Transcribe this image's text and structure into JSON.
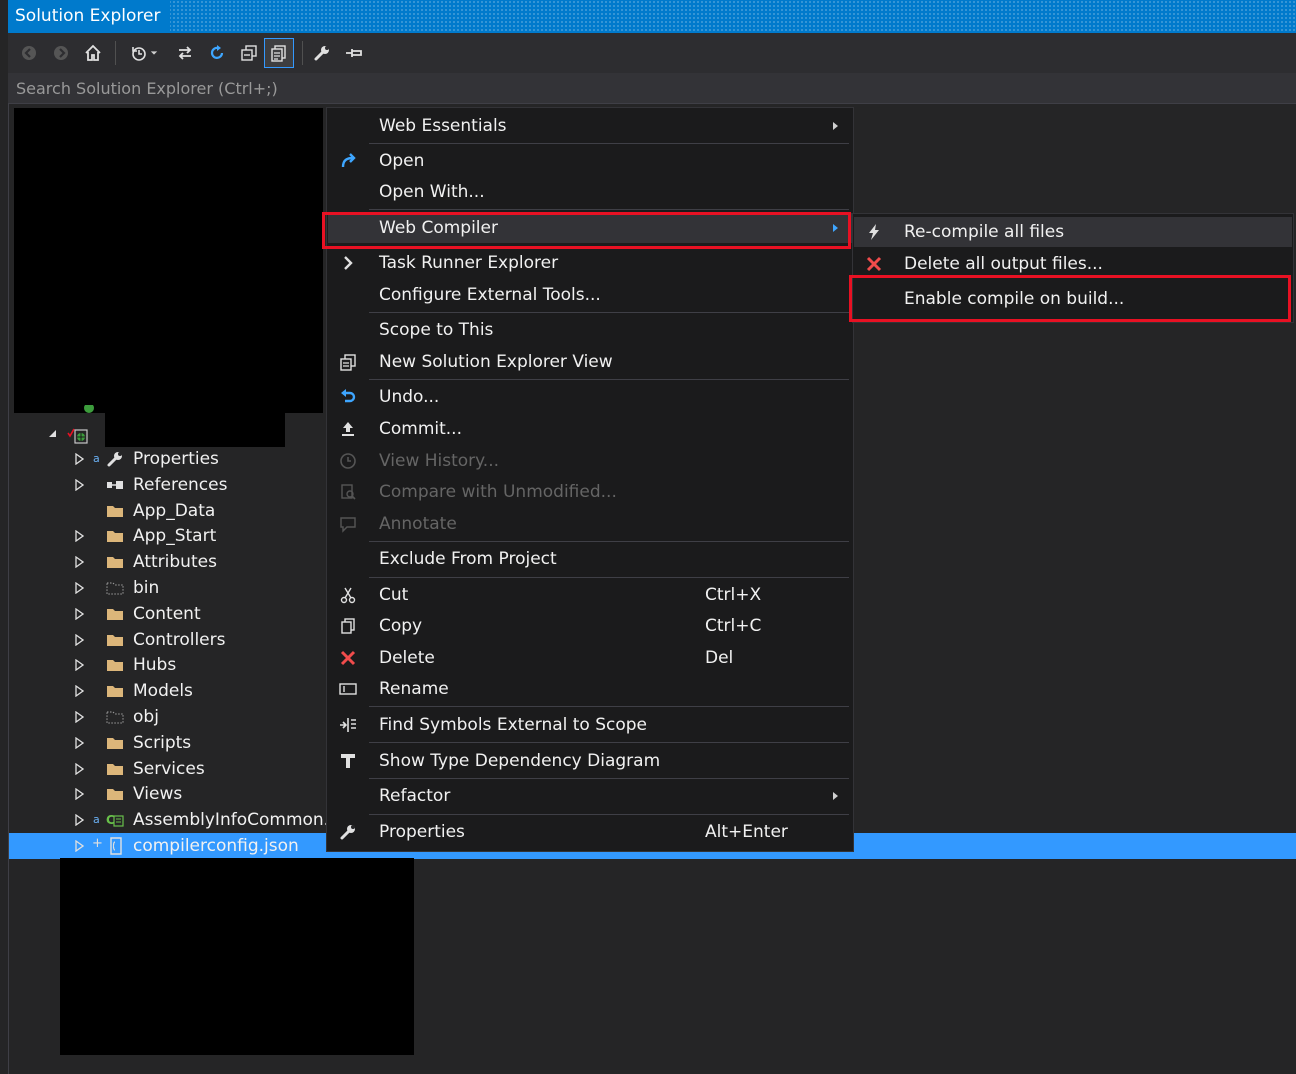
{
  "window": {
    "title": "Solution Explorer"
  },
  "search": {
    "placeholder": "Search Solution Explorer (Ctrl+;)"
  },
  "toolbar": {
    "buttons": [
      "back-icon",
      "forward-icon",
      "home-icon",
      "history-icon",
      "sync-icon",
      "refresh-icon",
      "collapse-all-icon",
      "show-all-files-icon",
      "properties-icon",
      "pin-icon"
    ]
  },
  "tree": {
    "items": [
      {
        "label": "Properties",
        "icon": "wrench-icon"
      },
      {
        "label": "References",
        "icon": "references-icon"
      },
      {
        "label": "App_Data",
        "icon": "folder-icon"
      },
      {
        "label": "App_Start",
        "icon": "folder-icon"
      },
      {
        "label": "Attributes",
        "icon": "folder-icon"
      },
      {
        "label": "bin",
        "icon": "dashed-folder-icon"
      },
      {
        "label": "Content",
        "icon": "folder-icon"
      },
      {
        "label": "Controllers",
        "icon": "folder-icon"
      },
      {
        "label": "Hubs",
        "icon": "folder-icon"
      },
      {
        "label": "Models",
        "icon": "folder-icon"
      },
      {
        "label": "obj",
        "icon": "dashed-folder-icon"
      },
      {
        "label": "Scripts",
        "icon": "folder-icon"
      },
      {
        "label": "Services",
        "icon": "folder-icon"
      },
      {
        "label": "Views",
        "icon": "folder-icon"
      },
      {
        "label": "AssemblyInfoCommon.cs",
        "icon": "csharp-file-icon"
      },
      {
        "label": "compilerconfig.json",
        "icon": "json-file-icon",
        "selected": true
      }
    ]
  },
  "context_menu": {
    "items": [
      {
        "label": "Web Essentials",
        "submenu": true
      },
      {
        "label": "Open",
        "icon": "open-icon"
      },
      {
        "label": "Open With..."
      },
      {
        "label": "Web Compiler",
        "submenu": true,
        "highlighted": true
      },
      {
        "label": "Task Runner Explorer",
        "icon": "chevron-right-icon"
      },
      {
        "label": "Configure External Tools..."
      },
      {
        "label": "Scope to This"
      },
      {
        "label": "New Solution Explorer View",
        "icon": "new-view-icon"
      },
      {
        "label": "Undo...",
        "icon": "undo-icon"
      },
      {
        "label": "Commit...",
        "icon": "commit-icon"
      },
      {
        "label": "View History...",
        "icon": "history-icon",
        "disabled": true
      },
      {
        "label": "Compare with Unmodified...",
        "icon": "compare-icon",
        "disabled": true
      },
      {
        "label": "Annotate",
        "icon": "annotate-icon",
        "disabled": true
      },
      {
        "label": "Exclude From Project"
      },
      {
        "label": "Cut",
        "icon": "cut-icon",
        "shortcut": "Ctrl+X"
      },
      {
        "label": "Copy",
        "icon": "copy-icon",
        "shortcut": "Ctrl+C"
      },
      {
        "label": "Delete",
        "icon": "delete-icon",
        "shortcut": "Del"
      },
      {
        "label": "Rename",
        "icon": "rename-icon"
      },
      {
        "label": "Find Symbols External to Scope",
        "icon": "find-symbols-icon"
      },
      {
        "label": "Show Type Dependency Diagram",
        "icon": "type-diagram-icon"
      },
      {
        "label": "Refactor",
        "submenu": true
      },
      {
        "label": "Properties",
        "icon": "wrench-icon",
        "shortcut": "Alt+Enter"
      }
    ]
  },
  "submenu": {
    "items": [
      {
        "label": "Re-compile all files",
        "icon": "lightning-icon"
      },
      {
        "label": "Delete all output files...",
        "icon": "delete-icon"
      },
      {
        "label": "Enable compile on build..."
      }
    ]
  },
  "colors": {
    "accent": "#007acc",
    "selection": "#3399ff",
    "highlight_box": "#e81123",
    "menu_bg": "#1b1b1c",
    "folder": "#dcb67a"
  }
}
